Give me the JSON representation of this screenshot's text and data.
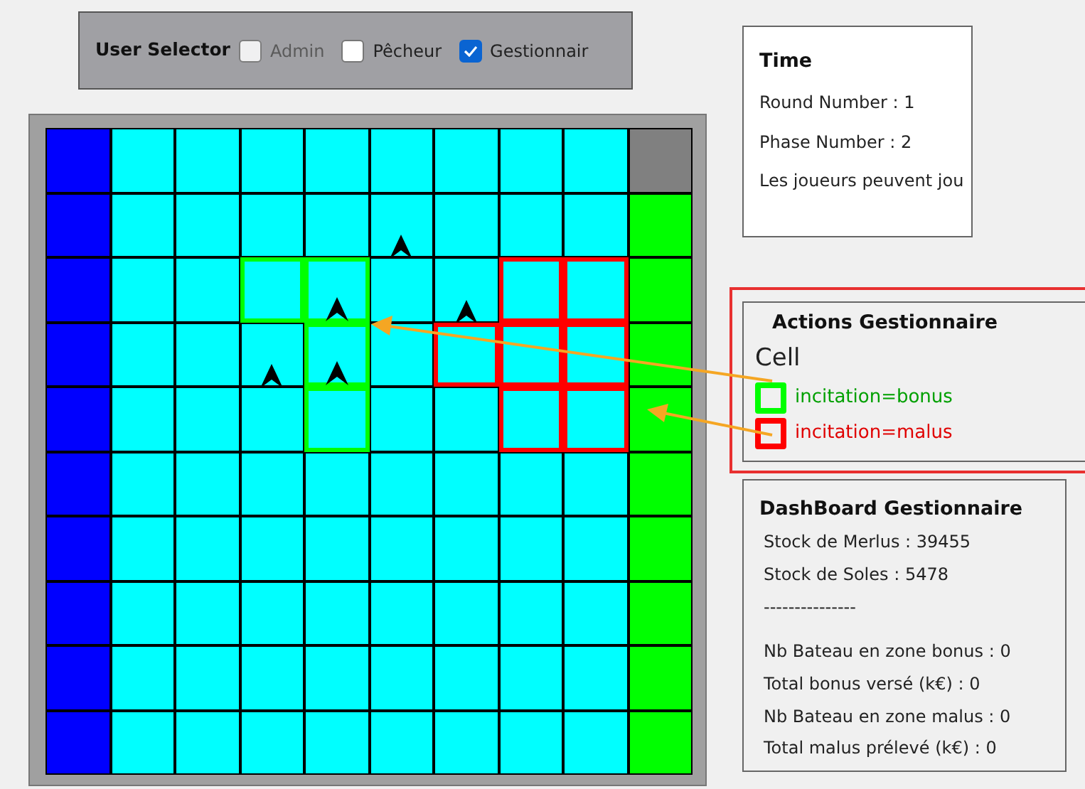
{
  "user_selector": {
    "label": "User Selector",
    "options": [
      {
        "label": "Admin",
        "checked": false,
        "disabled": true
      },
      {
        "label": "Pêcheur",
        "checked": false,
        "disabled": false
      },
      {
        "label": "Gestionnair",
        "checked": true,
        "disabled": false
      }
    ]
  },
  "grid": {
    "rows": [
      [
        {
          "kind": "land"
        },
        {
          "kind": "sea"
        },
        {
          "kind": "sea"
        },
        {
          "kind": "sea"
        },
        {
          "kind": "sea"
        },
        {
          "kind": "sea"
        },
        {
          "kind": "sea"
        },
        {
          "kind": "sea"
        },
        {
          "kind": "sea"
        },
        {
          "kind": "port"
        }
      ],
      [
        {
          "kind": "land"
        },
        {
          "kind": "sea"
        },
        {
          "kind": "sea"
        },
        {
          "kind": "sea"
        },
        {
          "kind": "sea"
        },
        {
          "kind": "sea",
          "boat": true
        },
        {
          "kind": "sea"
        },
        {
          "kind": "sea"
        },
        {
          "kind": "sea"
        },
        {
          "kind": "coast"
        }
      ],
      [
        {
          "kind": "land"
        },
        {
          "kind": "sea"
        },
        {
          "kind": "sea"
        },
        {
          "kind": "sea",
          "bonus": true
        },
        {
          "kind": "sea",
          "bonus": true,
          "boat": true
        },
        {
          "kind": "sea"
        },
        {
          "kind": "sea",
          "boat": true
        },
        {
          "kind": "sea",
          "malus": true
        },
        {
          "kind": "sea",
          "malus": true
        },
        {
          "kind": "coast"
        }
      ],
      [
        {
          "kind": "land"
        },
        {
          "kind": "sea"
        },
        {
          "kind": "sea"
        },
        {
          "kind": "sea",
          "boat": true
        },
        {
          "kind": "sea",
          "bonus": true,
          "boat": true
        },
        {
          "kind": "sea"
        },
        {
          "kind": "sea",
          "malus": true
        },
        {
          "kind": "sea",
          "malus": true
        },
        {
          "kind": "sea",
          "malus": true
        },
        {
          "kind": "coast"
        }
      ],
      [
        {
          "kind": "land"
        },
        {
          "kind": "sea"
        },
        {
          "kind": "sea"
        },
        {
          "kind": "sea"
        },
        {
          "kind": "sea",
          "bonus": true
        },
        {
          "kind": "sea"
        },
        {
          "kind": "sea"
        },
        {
          "kind": "sea",
          "malus": true
        },
        {
          "kind": "sea",
          "malus": true
        },
        {
          "kind": "coast"
        }
      ],
      [
        {
          "kind": "land"
        },
        {
          "kind": "sea"
        },
        {
          "kind": "sea"
        },
        {
          "kind": "sea"
        },
        {
          "kind": "sea"
        },
        {
          "kind": "sea"
        },
        {
          "kind": "sea"
        },
        {
          "kind": "sea"
        },
        {
          "kind": "sea"
        },
        {
          "kind": "coast"
        }
      ],
      [
        {
          "kind": "land"
        },
        {
          "kind": "sea"
        },
        {
          "kind": "sea"
        },
        {
          "kind": "sea"
        },
        {
          "kind": "sea"
        },
        {
          "kind": "sea"
        },
        {
          "kind": "sea"
        },
        {
          "kind": "sea"
        },
        {
          "kind": "sea"
        },
        {
          "kind": "coast"
        }
      ],
      [
        {
          "kind": "land"
        },
        {
          "kind": "sea"
        },
        {
          "kind": "sea"
        },
        {
          "kind": "sea"
        },
        {
          "kind": "sea"
        },
        {
          "kind": "sea"
        },
        {
          "kind": "sea"
        },
        {
          "kind": "sea"
        },
        {
          "kind": "sea"
        },
        {
          "kind": "coast"
        }
      ],
      [
        {
          "kind": "land"
        },
        {
          "kind": "sea"
        },
        {
          "kind": "sea"
        },
        {
          "kind": "sea"
        },
        {
          "kind": "sea"
        },
        {
          "kind": "sea"
        },
        {
          "kind": "sea"
        },
        {
          "kind": "sea"
        },
        {
          "kind": "sea"
        },
        {
          "kind": "coast"
        }
      ],
      [
        {
          "kind": "land"
        },
        {
          "kind": "sea"
        },
        {
          "kind": "sea"
        },
        {
          "kind": "sea"
        },
        {
          "kind": "sea"
        },
        {
          "kind": "sea"
        },
        {
          "kind": "sea"
        },
        {
          "kind": "sea"
        },
        {
          "kind": "sea"
        },
        {
          "kind": "coast"
        }
      ]
    ]
  },
  "time": {
    "title": "Time",
    "lines": [
      "Round Number : 1",
      "Phase Number : 2",
      "Les joueurs peuvent jou"
    ]
  },
  "actions": {
    "title": "Actions Gestionnaire",
    "subtitle": "Cell",
    "legend": [
      {
        "label": "incitation=bonus",
        "color": "#00ff00"
      },
      {
        "label": "incitation=malus",
        "color": "#ff0000"
      }
    ]
  },
  "dashboard": {
    "title": "DashBoard Gestionnaire",
    "lines": [
      "Stock de Merlus : 39455",
      "Stock de Soles : 5478",
      "---------------",
      "Nb Bateau en zone bonus : 0",
      "Total bonus versé (k€) : 0",
      "Nb Bateau en zone malus : 0",
      "Total malus prélevé (k€) : 0"
    ]
  }
}
